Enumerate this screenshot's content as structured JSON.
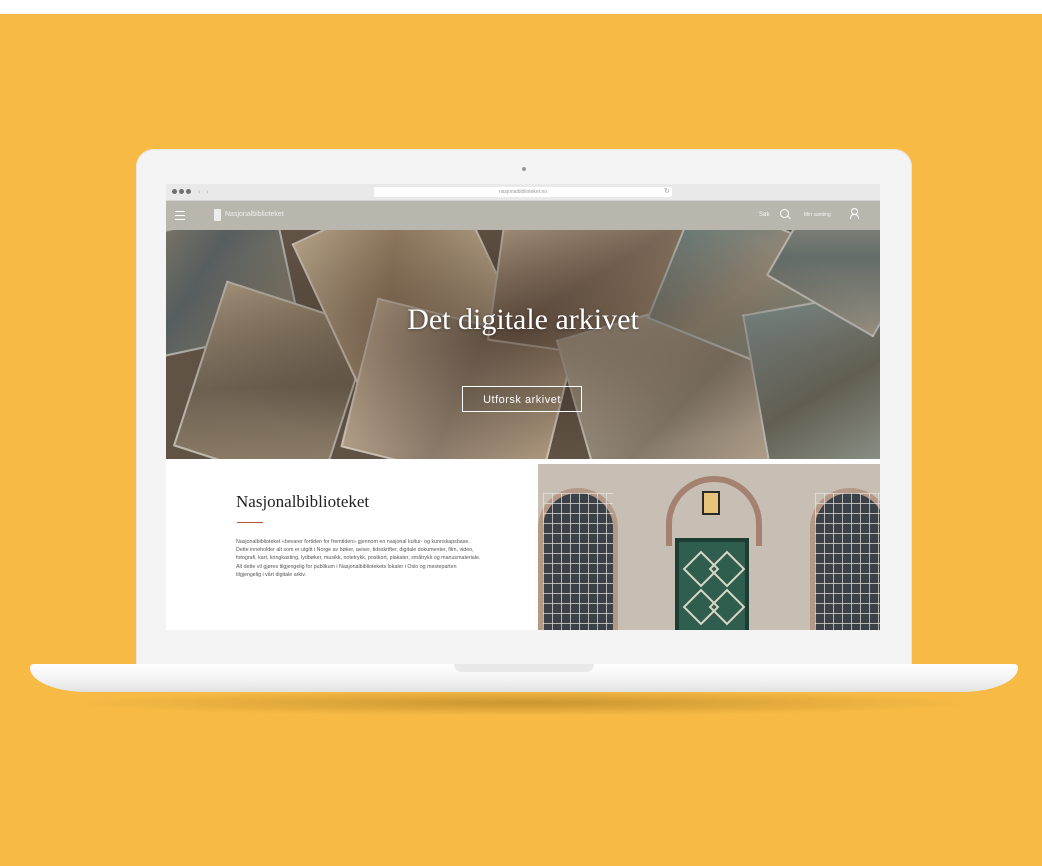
{
  "browser": {
    "url": "nasjonalbiblioteket.no"
  },
  "site": {
    "name": "Nasjonalbiblioteket",
    "search_label": "Søk",
    "account_label": "Min samling"
  },
  "hero": {
    "title": "Det digitale arkivet",
    "button_label": "Utforsk arkivet"
  },
  "intro": {
    "title": "Nasjonalbiblioteket",
    "body": "Nasjonalbiblioteket «bevarer fortiden for fremtiden» gjennom en nasjonal kultur- og kunnskapsbase. Dette inneholder alt som er utgitt i Norge av bøker, aviser, tidsskrifter, digitale dokumenter, film, video, fotografi, kart, kringkasting, lydbøker, musikk, notetrykk, postkort, plakater, småtrykk og manusmateriale. Alt dette vil gjøres tilgjengelig for publikum i Nasjonalbibliotekets lokaler i Oslo og mesteparten tilgjengelig i vårt digitale arkiv."
  },
  "colors": {
    "background": "#f7bb45",
    "nav": "#b9b7ad",
    "accent": "#b5553a"
  }
}
